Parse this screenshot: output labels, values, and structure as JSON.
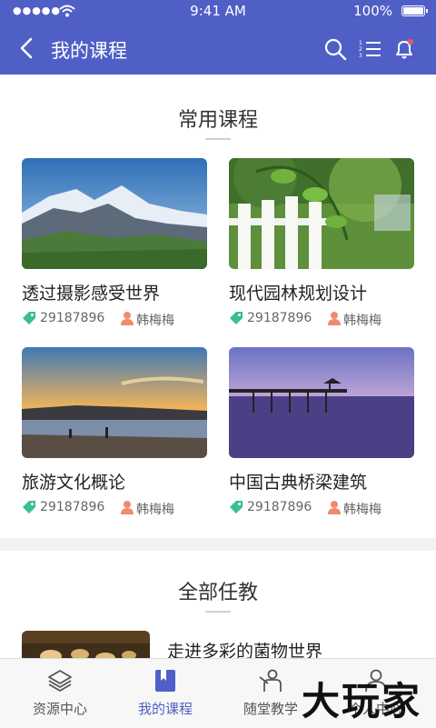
{
  "status_bar": {
    "signal": "●●●●●",
    "time": "9:41 AM",
    "battery": "100%"
  },
  "navbar": {
    "title": "我的课程"
  },
  "common_section": {
    "title": "常用课程"
  },
  "courses": [
    {
      "name": "透过摄影感受世界",
      "count": "29187896",
      "author": "韩梅梅",
      "image": "mountain"
    },
    {
      "name": "现代园林规划设计",
      "count": "29187896",
      "author": "韩梅梅",
      "image": "garden"
    },
    {
      "name": "旅游文化概论",
      "count": "29187896",
      "author": "韩梅梅",
      "image": "beach"
    },
    {
      "name": "中国古典桥梁建筑",
      "count": "29187896",
      "author": "韩梅梅",
      "image": "pier"
    }
  ],
  "all_section": {
    "title": "全部任教"
  },
  "list": [
    {
      "title": "走进多彩的菌物世界",
      "image": "mushrooms"
    }
  ],
  "tabs": [
    {
      "label": "资源中心",
      "icon": "layers-icon",
      "active": false
    },
    {
      "label": "我的课程",
      "icon": "bookmark-book-icon",
      "active": true
    },
    {
      "label": "随堂教学",
      "icon": "teacher-icon",
      "active": false
    },
    {
      "label": "个人中心",
      "icon": "person-icon",
      "active": false
    }
  ],
  "watermark": "大玩家",
  "colors": {
    "primary": "#4f5fc6",
    "tag": "#3cbf8e",
    "user": "#f08a6e"
  }
}
